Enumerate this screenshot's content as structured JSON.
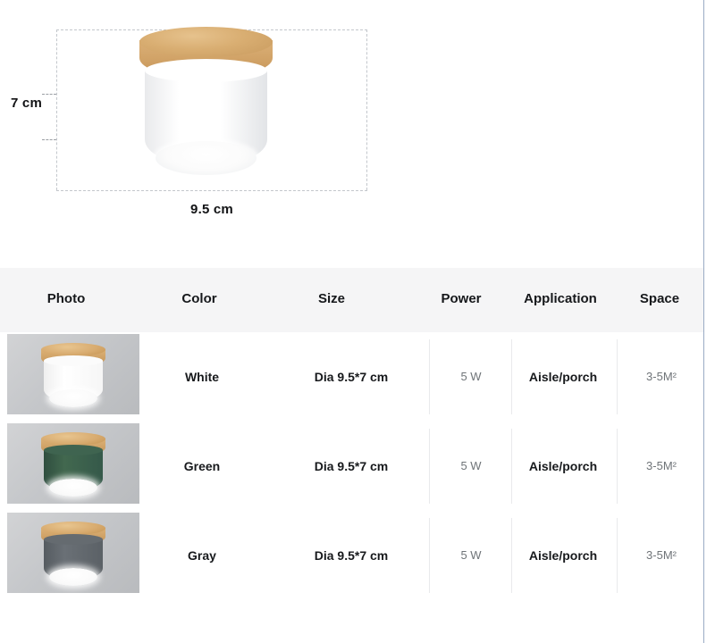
{
  "hero": {
    "alt": "ceiling-spotlight-dimension-diagram",
    "height_label": "7 cm",
    "width_label": "9.5 cm"
  },
  "table": {
    "headers": [
      "Photo",
      "Color",
      "Size",
      "Power",
      "Application",
      "Space"
    ],
    "rows": [
      {
        "photo": "white-lamp-thumbnail",
        "color": "White",
        "size": "Dia 9.5*7 cm",
        "power": "5 W",
        "application": "Aisle/porch",
        "space": "3-5M²",
        "swatch": "#f4f5f6"
      },
      {
        "photo": "green-lamp-thumbnail",
        "color": "Green",
        "size": "Dia 9.5*7 cm",
        "power": "5 W",
        "application": "Aisle/porch",
        "space": "3-5M²",
        "swatch": "#3a5e4c"
      },
      {
        "photo": "gray-lamp-thumbnail",
        "color": "Gray",
        "size": "Dia 9.5*7 cm",
        "power": "5 W",
        "application": "Aisle/porch",
        "space": "3-5M²",
        "swatch": "#60666b"
      }
    ]
  },
  "colors": {
    "header_bg": "#f5f5f6",
    "text_strong": "#17191c",
    "text_muted": "#6f7478",
    "divider": "#e9eaec",
    "page_edge": "#9aabc4",
    "wood": "#cfa064"
  }
}
